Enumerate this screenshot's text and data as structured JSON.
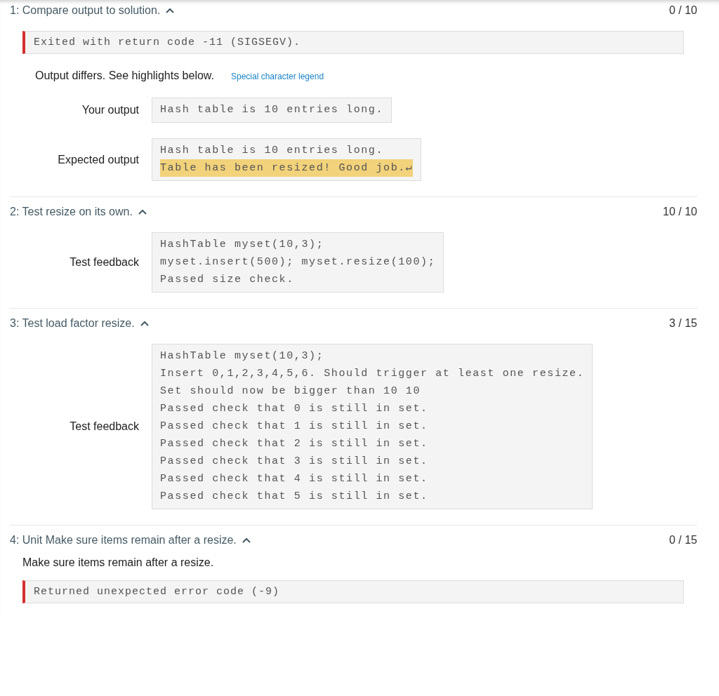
{
  "tests": [
    {
      "title": "1: Compare output to solution.",
      "expanded": true,
      "score": "0 / 10",
      "blocks": [
        {
          "kind": "error",
          "text": "Exited with return code -11 (SIGSEGV)."
        },
        {
          "kind": "note",
          "text": "Output differs. See highlights below.",
          "link": "Special character legend"
        },
        {
          "kind": "labeled",
          "label": "Your output",
          "lines": [
            {
              "text": "Hash table is 10 entries long.",
              "highlighted": false
            }
          ]
        },
        {
          "kind": "labeled",
          "label": "Expected output",
          "lines": [
            {
              "text": "Hash table is 10 entries long.",
              "highlighted": false
            },
            {
              "text": "Table has been resized! Good job.↵",
              "highlighted": true
            }
          ]
        }
      ]
    },
    {
      "title": "2: Test resize on its own.",
      "expanded": true,
      "score": "10 / 10",
      "blocks": [
        {
          "kind": "labeled",
          "label": "Test feedback",
          "lines": [
            {
              "text": "HashTable myset(10,3);",
              "highlighted": false
            },
            {
              "text": "myset.insert(500); myset.resize(100);",
              "highlighted": false
            },
            {
              "text": "Passed size check.",
              "highlighted": false
            }
          ]
        }
      ]
    },
    {
      "title": "3: Test load factor resize.",
      "expanded": true,
      "score": "3 / 15",
      "blocks": [
        {
          "kind": "labeled",
          "label": "Test feedback",
          "lines": [
            {
              "text": "HashTable myset(10,3);",
              "highlighted": false
            },
            {
              "text": "Insert 0,1,2,3,4,5,6. Should trigger at least one resize.",
              "highlighted": false
            },
            {
              "text": "Set should now be bigger than 10 10",
              "highlighted": false
            },
            {
              "text": "Passed check that 0 is still in set.",
              "highlighted": false
            },
            {
              "text": "Passed check that 1 is still in set.",
              "highlighted": false
            },
            {
              "text": "Passed check that 2 is still in set.",
              "highlighted": false
            },
            {
              "text": "Passed check that 3 is still in set.",
              "highlighted": false
            },
            {
              "text": "Passed check that 4 is still in set.",
              "highlighted": false
            },
            {
              "text": "Passed check that 5 is still in set.",
              "highlighted": false
            }
          ]
        }
      ]
    },
    {
      "title": "4: Unit Make sure items remain after a resize.",
      "expanded": true,
      "score": "0 / 15",
      "blocks": [
        {
          "kind": "description",
          "text": "Make sure items remain after a resize."
        },
        {
          "kind": "error",
          "text": "Returned unexpected error code (-9)"
        }
      ]
    }
  ]
}
